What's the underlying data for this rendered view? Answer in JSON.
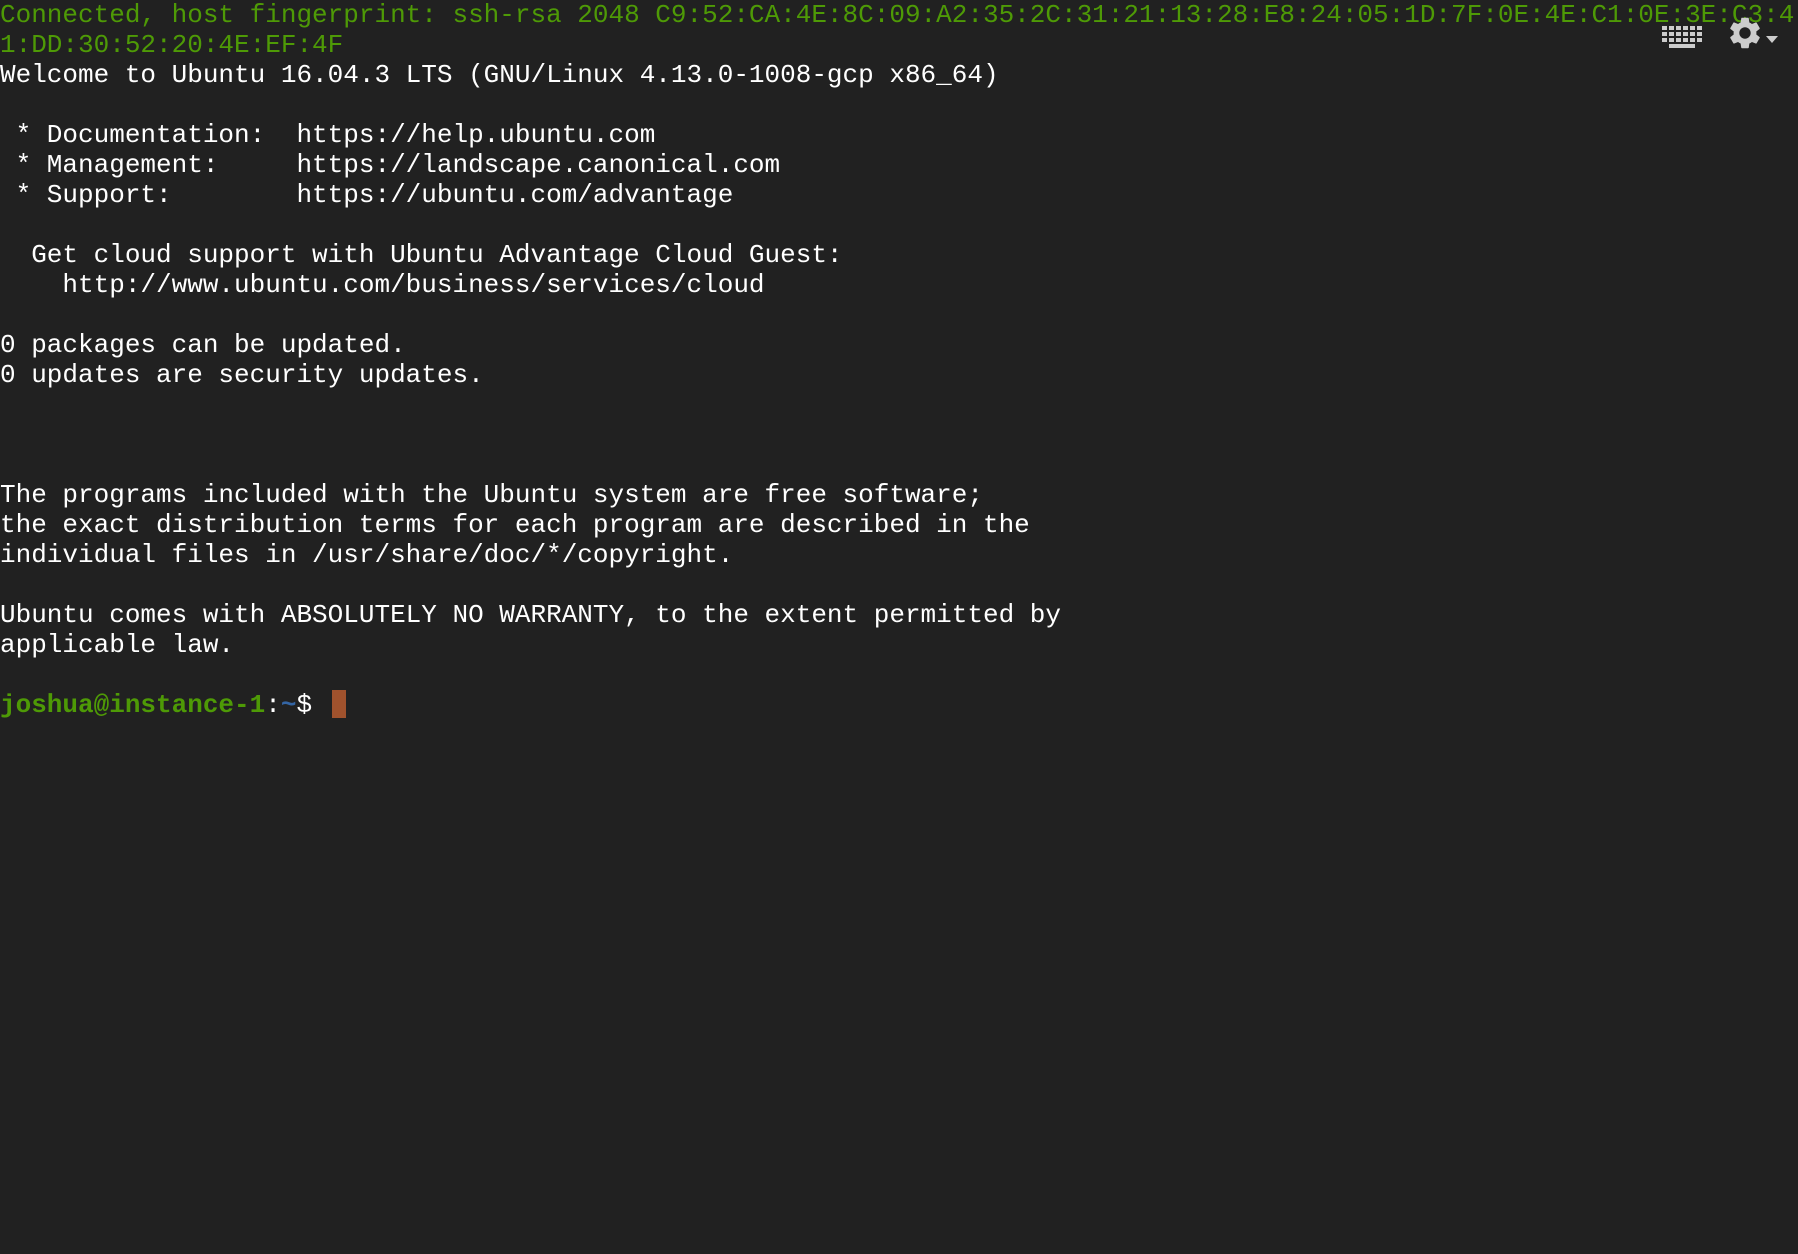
{
  "terminal": {
    "fingerprint_line_1": "Connected, host fingerprint: ssh-rsa 2048 C9:52:CA:4E:8C:09:A2:35:2C:31:21:13:28:E8:24:05:1D:7F:0E:4E:C1:0E:3E:C3:4",
    "fingerprint_line_2": "1:DD:30:52:20:4E:EF:4F",
    "welcome": "Welcome to Ubuntu 16.04.3 LTS (GNU/Linux 4.13.0-1008-gcp x86_64)",
    "doc_line": " * Documentation:  https://help.ubuntu.com",
    "mgmt_line": " * Management:     https://landscape.canonical.com",
    "support_line": " * Support:        https://ubuntu.com/advantage",
    "cloud_line_1": "  Get cloud support with Ubuntu Advantage Cloud Guest:",
    "cloud_line_2": "    http://www.ubuntu.com/business/services/cloud",
    "pkg_line_1": "0 packages can be updated.",
    "pkg_line_2": "0 updates are security updates.",
    "legal_1": "The programs included with the Ubuntu system are free software;",
    "legal_2": "the exact distribution terms for each program are described in the",
    "legal_3": "individual files in /usr/share/doc/*/copyright.",
    "warranty_1": "Ubuntu comes with ABSOLUTELY NO WARRANTY, to the extent permitted by",
    "warranty_2": "applicable law.",
    "prompt_user": "joshua@instance-1",
    "prompt_colon": ":",
    "prompt_path": "~",
    "prompt_symbol": "$ "
  },
  "toolbar": {
    "keyboard_icon": "keyboard-icon",
    "settings_icon": "gear-icon",
    "dropdown_icon": "chevron-down-icon"
  },
  "colors": {
    "background": "#212121",
    "text": "#ffffff",
    "green": "#4e9a06",
    "blue": "#3465a4",
    "cursor": "#a0522d"
  }
}
